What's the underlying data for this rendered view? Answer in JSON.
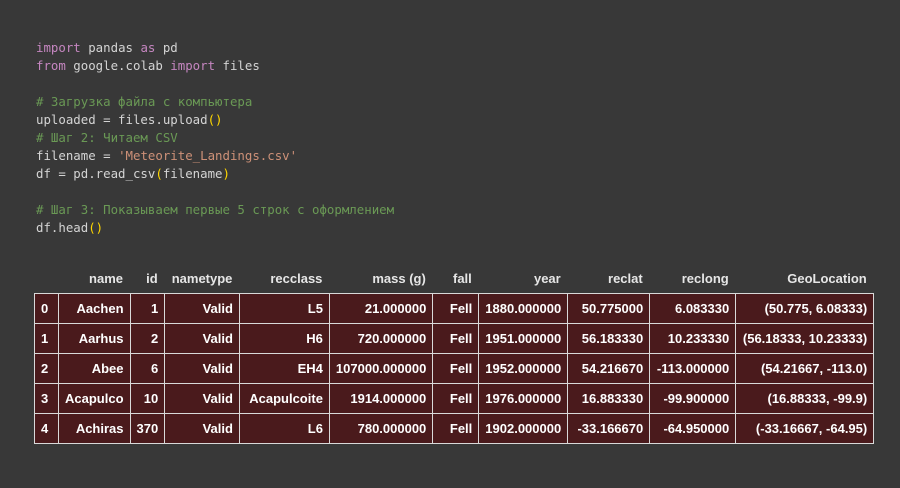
{
  "code_lines": [
    [
      {
        "t": "import",
        "c": "kw"
      },
      {
        "t": " pandas ",
        "c": ""
      },
      {
        "t": "as",
        "c": "kw"
      },
      {
        "t": " pd",
        "c": ""
      }
    ],
    [
      {
        "t": "from",
        "c": "kw"
      },
      {
        "t": " google.colab ",
        "c": ""
      },
      {
        "t": "import",
        "c": "kw"
      },
      {
        "t": " files",
        "c": ""
      }
    ],
    [],
    [
      {
        "t": "# Загрузка файла с компьютера",
        "c": "cm"
      }
    ],
    [
      {
        "t": "uploaded = files.upload",
        "c": ""
      },
      {
        "t": "()",
        "c": "par"
      }
    ],
    [
      {
        "t": "# Шаг 2: Читаем CSV",
        "c": "cm"
      }
    ],
    [
      {
        "t": "filename = ",
        "c": ""
      },
      {
        "t": "'Meteorite_Landings.csv'",
        "c": "str"
      }
    ],
    [
      {
        "t": "df = pd.read_csv",
        "c": ""
      },
      {
        "t": "(",
        "c": "par"
      },
      {
        "t": "filename",
        "c": ""
      },
      {
        "t": ")",
        "c": "par"
      }
    ],
    [],
    [
      {
        "t": "# Шаг 3: Показываем первые 5 строк с оформлением",
        "c": "cm"
      }
    ],
    [
      {
        "t": "df.head",
        "c": ""
      },
      {
        "t": "()",
        "c": "par"
      }
    ]
  ],
  "table": {
    "columns": [
      "",
      "name",
      "id",
      "nametype",
      "recclass",
      "mass (g)",
      "fall",
      "year",
      "reclat",
      "reclong",
      "GeoLocation"
    ],
    "rows": [
      [
        "0",
        "Aachen",
        "1",
        "Valid",
        "L5",
        "21.000000",
        "Fell",
        "1880.000000",
        "50.775000",
        "6.083330",
        "(50.775, 6.08333)"
      ],
      [
        "1",
        "Aarhus",
        "2",
        "Valid",
        "H6",
        "720.000000",
        "Fell",
        "1951.000000",
        "56.183330",
        "10.233330",
        "(56.18333, 10.23333)"
      ],
      [
        "2",
        "Abee",
        "6",
        "Valid",
        "EH4",
        "107000.000000",
        "Fell",
        "1952.000000",
        "54.216670",
        "-113.000000",
        "(54.21667, -113.0)"
      ],
      [
        "3",
        "Acapulco",
        "10",
        "Valid",
        "Acapulcoite",
        "1914.000000",
        "Fell",
        "1976.000000",
        "16.883330",
        "-99.900000",
        "(16.88333, -99.9)"
      ],
      [
        "4",
        "Achiras",
        "370",
        "Valid",
        "L6",
        "780.000000",
        "Fell",
        "1902.000000",
        "-33.166670",
        "-64.950000",
        "(-33.16667, -64.95)"
      ]
    ]
  },
  "colors": {
    "background": "#383838",
    "cell_background": "#4a1a1c",
    "keyword": "#c586c0",
    "comment": "#6a9955",
    "string": "#ce9178",
    "paren": "#ffd700"
  }
}
